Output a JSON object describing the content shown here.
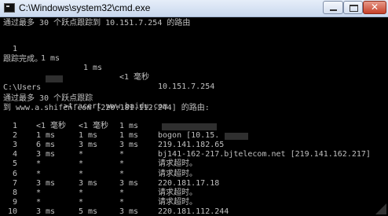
{
  "window": {
    "title": "C:\\Windows\\system32\\cmd.exe",
    "close_symbol": "✕"
  },
  "console": {
    "line_trace1_header": "通过最多 30 个跃点跟踪到 10.151.7.254 的路由",
    "first_trace": [
      "1",
      "1 ms",
      "1 ms",
      "<1 毫秒",
      "10.151.7.254"
    ],
    "trace_complete": "跟踪完成。",
    "prompt_prefix": "C:\\Users",
    "prompt_command": ">tracert www.baidu.com",
    "header2_line1": "通过最多 30 个跃点跟踪",
    "header2_line2": "到 www.a.shifen.com [220.181.112.244] 的路由:",
    "hops": [
      {
        "n": "1",
        "t1": "<1 毫秒",
        "t2": "<1 毫秒",
        "t3": "1 ms",
        "dest": ""
      },
      {
        "n": "2",
        "t1": "1 ms",
        "t2": "1 ms",
        "t3": "1 ms",
        "dest": "bogon [10.15."
      },
      {
        "n": "3",
        "t1": "6 ms",
        "t2": "3 ms",
        "t3": "3 ms",
        "dest": "219.141.182.65"
      },
      {
        "n": "4",
        "t1": "3 ms",
        "t2": "*",
        "t3": "*",
        "dest": "bj141-162-217.bjtelecom.net [219.141.162.217]"
      },
      {
        "n": "5",
        "t1": "*",
        "t2": "*",
        "t3": "*",
        "dest": "请求超时。"
      },
      {
        "n": "6",
        "t1": "*",
        "t2": "*",
        "t3": "*",
        "dest": "请求超时。"
      },
      {
        "n": "7",
        "t1": "3 ms",
        "t2": "3 ms",
        "t3": "3 ms",
        "dest": "220.181.17.18"
      },
      {
        "n": "8",
        "t1": "*",
        "t2": "*",
        "t3": "*",
        "dest": "请求超时。"
      },
      {
        "n": "9",
        "t1": "*",
        "t2": "*",
        "t3": "*",
        "dest": "请求超时。"
      },
      {
        "n": "10",
        "t1": "3 ms",
        "t2": "5 ms",
        "t3": "3 ms",
        "dest": "220.181.112.244"
      }
    ]
  },
  "colors": {
    "console_bg": "#000000",
    "console_text": "#c0c0c0",
    "titlebar_top": "#e6eef9",
    "close_button": "#c7412a"
  }
}
